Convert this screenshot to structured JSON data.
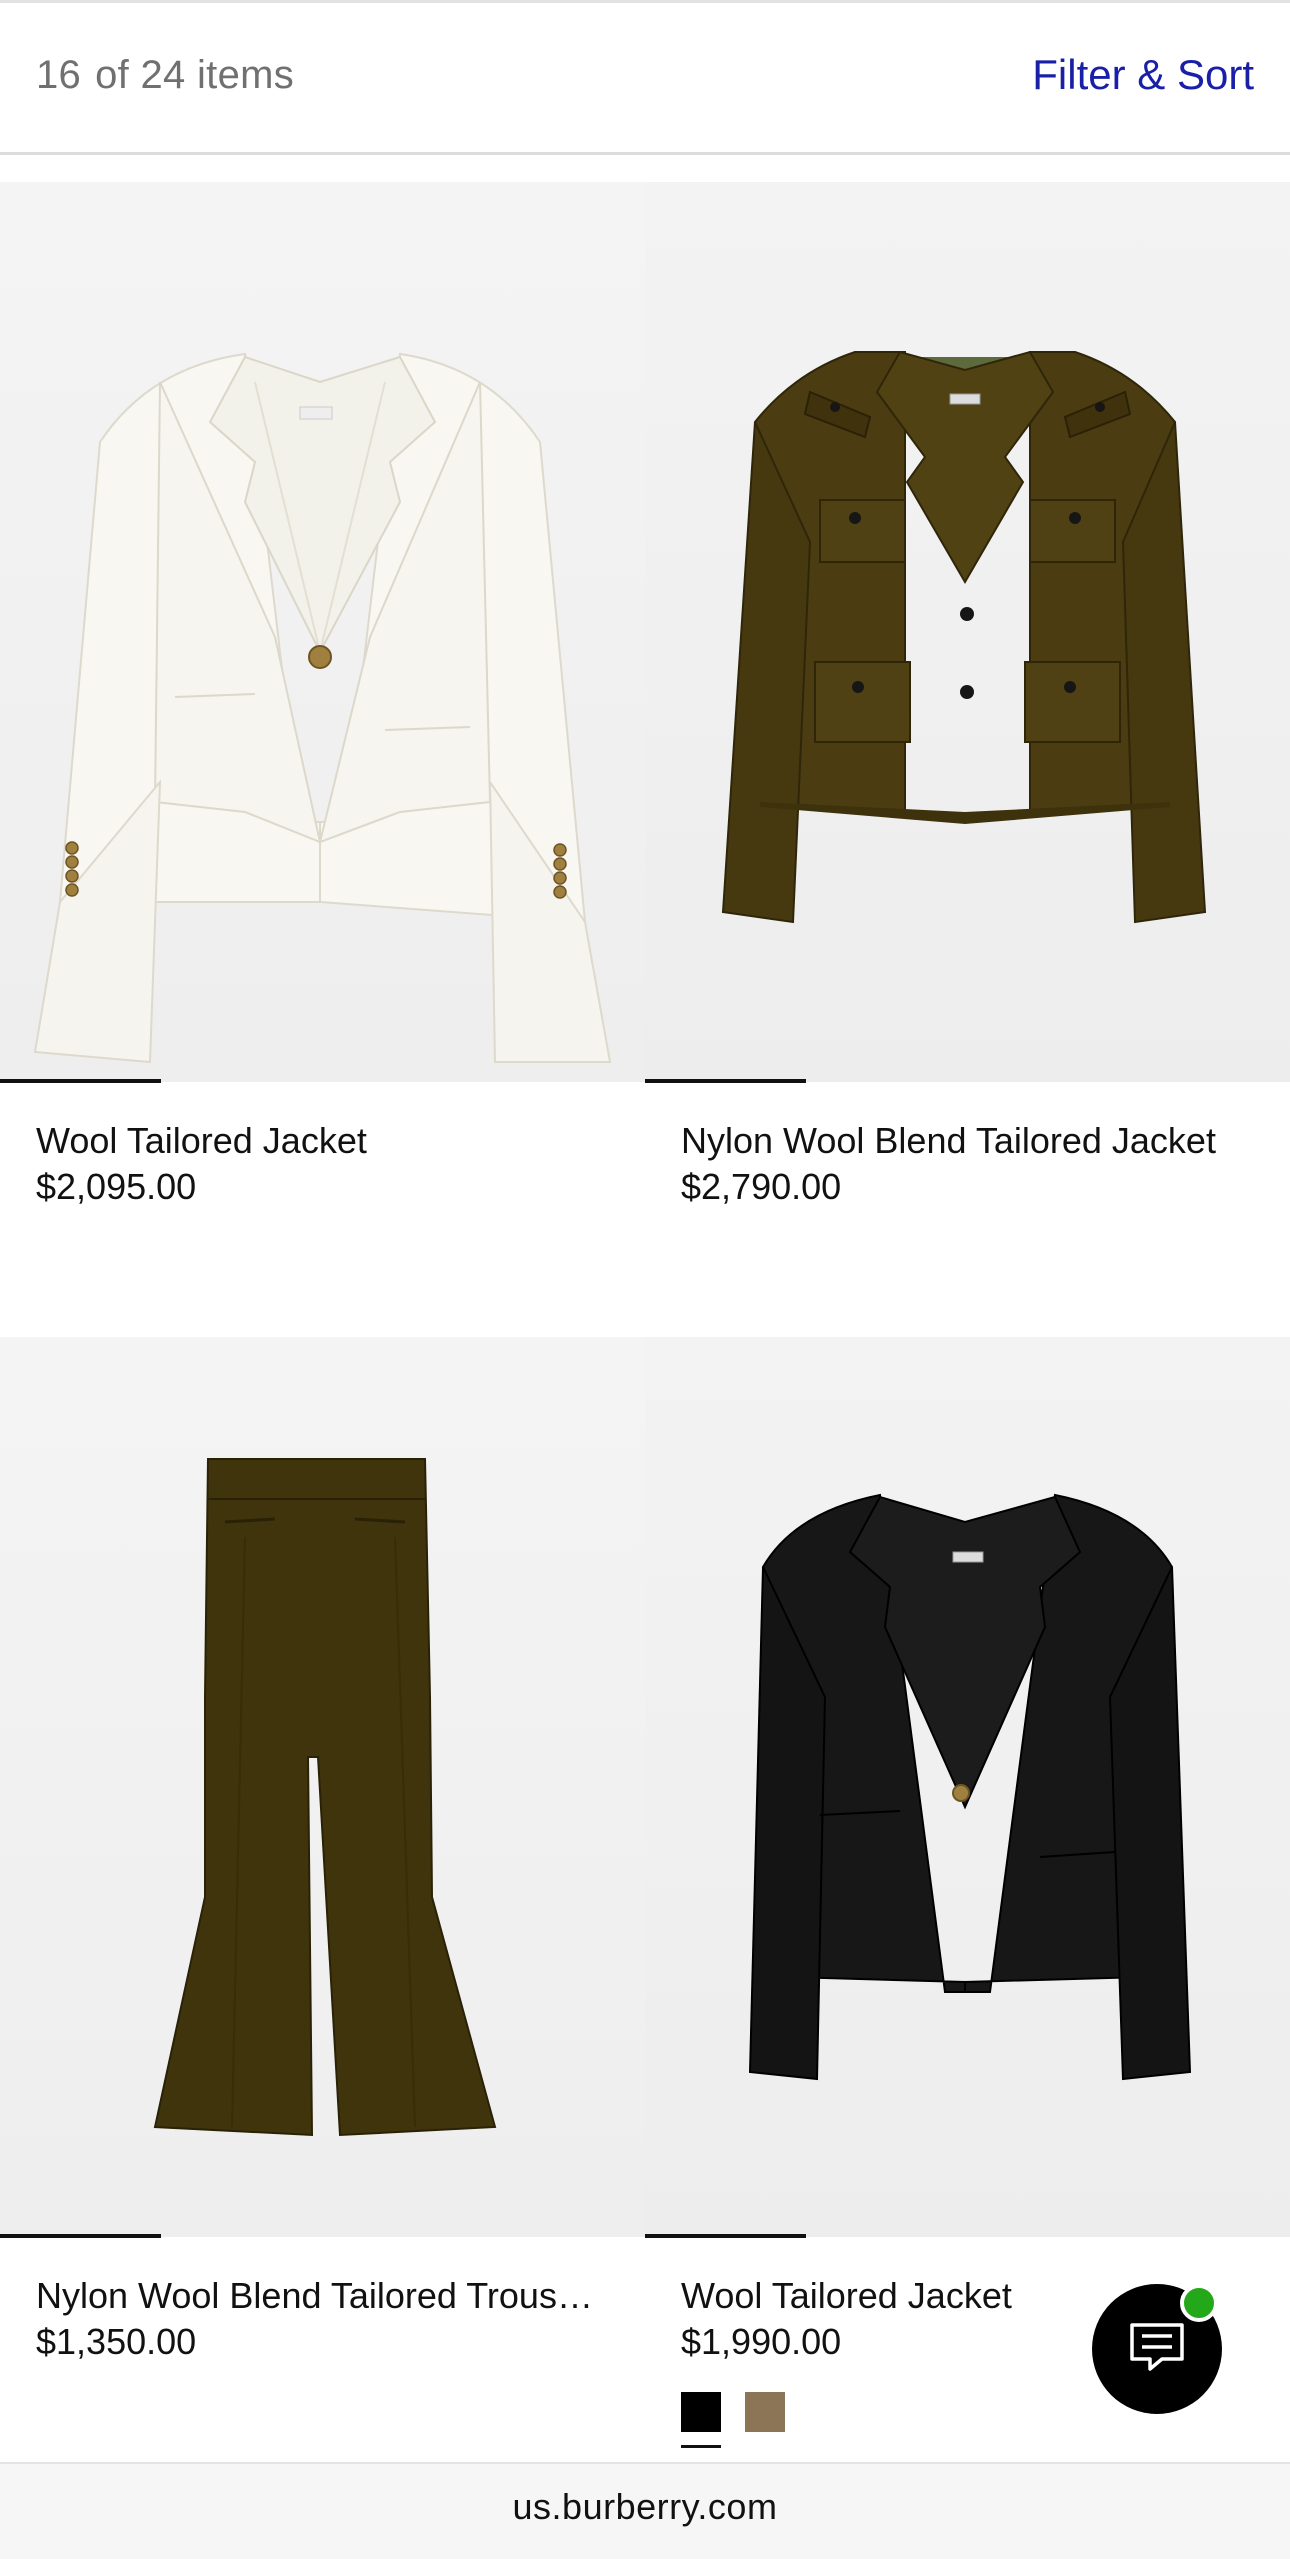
{
  "toolbar": {
    "count_current": "16",
    "count_rest": "of 24 items",
    "filter_label": "Filter & Sort",
    "filter_color": "#1a1fa8"
  },
  "products": [
    {
      "name": "Wool Tailored Jacket",
      "price": "$2,095.00",
      "image": "white-tailored-jacket",
      "image_progress": 0.25,
      "color": "#f5f4ef"
    },
    {
      "name": "Nylon Wool Blend Tailored Jacket",
      "price": "$2,790.00",
      "image": "olive-military-jacket",
      "image_progress": 0.25,
      "color": "#4a3d12"
    },
    {
      "name": "Nylon Wool Blend Tailored Trous…",
      "price": "$1,350.00",
      "image": "olive-flared-trousers",
      "image_progress": 0.25,
      "color": "#3f340c"
    },
    {
      "name": "Wool Tailored Jacket",
      "price": "$1,990.00",
      "image": "black-tailored-jacket",
      "image_progress": 0.25,
      "color": "#161616"
    }
  ],
  "swatches": [
    {
      "name": "black",
      "color": "#000000",
      "selected": true
    },
    {
      "name": "taupe",
      "color": "#8c7556",
      "selected": false
    }
  ],
  "chat": {
    "icon": "chat-icon",
    "status_color": "#23a81a"
  },
  "footer": {
    "url": "us.burberry.com"
  }
}
